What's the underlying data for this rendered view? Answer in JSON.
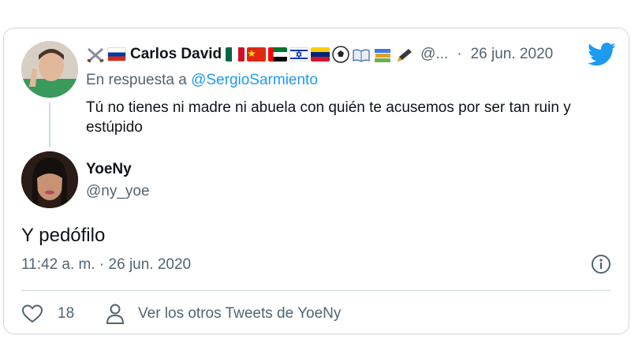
{
  "quoted_tweet": {
    "display_name": "Carlos David",
    "handle_truncated": "@...",
    "separator": "·",
    "date": "26 jun. 2020",
    "reply_prefix": "En respuesta a",
    "reply_handle": "@SergioSarmiento",
    "text": "Tú no tienes ni madre ni abuela con quién te acusemos por ser tan ruin y estúpido",
    "name_emojis_before": [
      "crossed-swords-icon",
      "russia-flag-icon"
    ],
    "name_emojis_after": [
      "mexico-flag-icon",
      "china-flag-icon",
      "uae-flag-icon",
      "israel-flag-icon",
      "venezuela-flag-icon",
      "soccer-ball-icon",
      "open-book-icon",
      "books-icon",
      "pen-icon"
    ]
  },
  "main_tweet": {
    "display_name": "YoeNy",
    "handle": "@ny_yoe",
    "text": "Y pedófilo",
    "timestamp": "11:42 a. m. · 26 jun. 2020"
  },
  "actions": {
    "like_count": "18",
    "more_tweets_label": "Ver los otros Tweets de YoeNy"
  },
  "colors": {
    "accent": "#1d9bf0",
    "secondary_text": "#536471",
    "border": "#cfd9de"
  }
}
